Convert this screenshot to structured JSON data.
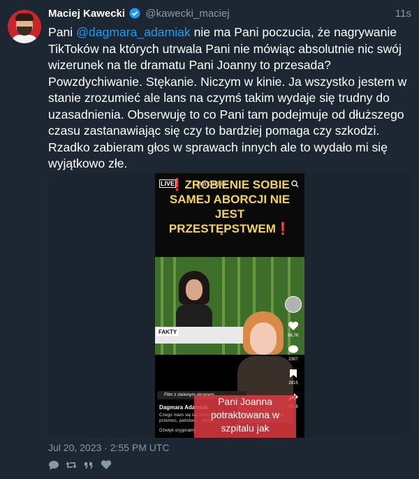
{
  "tweet": {
    "author_name": "Maciej Kawecki",
    "handle": "@kawecki_maciej",
    "time_ago": "11s",
    "mention": "@dagmara_adamiak",
    "text_before": "Pani ",
    "text_after": " nie ma Pani poczucia, że nagrywanie TikToków na których utrwala Pani nie mówiąc absolutnie nic swój wizerunek na tle dramatu Pani Joanny to przesada? Powzdychiwanie. Stękanie. Niczym w kinie. Ja wszystko jestem w stanie zrozumieć ale lans na czymś takim wydaje się trudny do uzasadnienia. Obserwuję to co Pani tam podejmuje od dłuższego czasu zastanawiając się czy to bardziej pomaga czy szkodzi. Rzadko zabieram głos w sprawach innych ale to wydało mi się wyjątkowo złe.",
    "timestamp": "Jul 20, 2023 · 2:55 PM UTC"
  },
  "media": {
    "banner_text": "❗ZROBIENIE SOBIE\nSAMEJ ABORCJI NIE\nJEST\nPRZESTĘPSTWEM❗",
    "live_badge": "LIVE",
    "topbar_text": "Dla Ciebie",
    "fakty_label": "FAKTY",
    "green_screen_label": "Film z zielonym ekranem",
    "author": "Dagmara Adamiak",
    "description": "Czego mam się tak bardzo powiedzieć jako zastraszyc, to jest przemoc, państwo... więcej",
    "music": "Dźwięk oryginalny",
    "caption": "Pani Joanna potraktowana w szpitalu jak przestępczyni, bo",
    "counts": [
      "86,7K",
      "2307",
      "2815",
      "6518"
    ]
  },
  "colors": {
    "background": "#1c2733",
    "link": "#1d9bf0",
    "muted": "#8899a6",
    "banner_text": "#f3d35c"
  }
}
